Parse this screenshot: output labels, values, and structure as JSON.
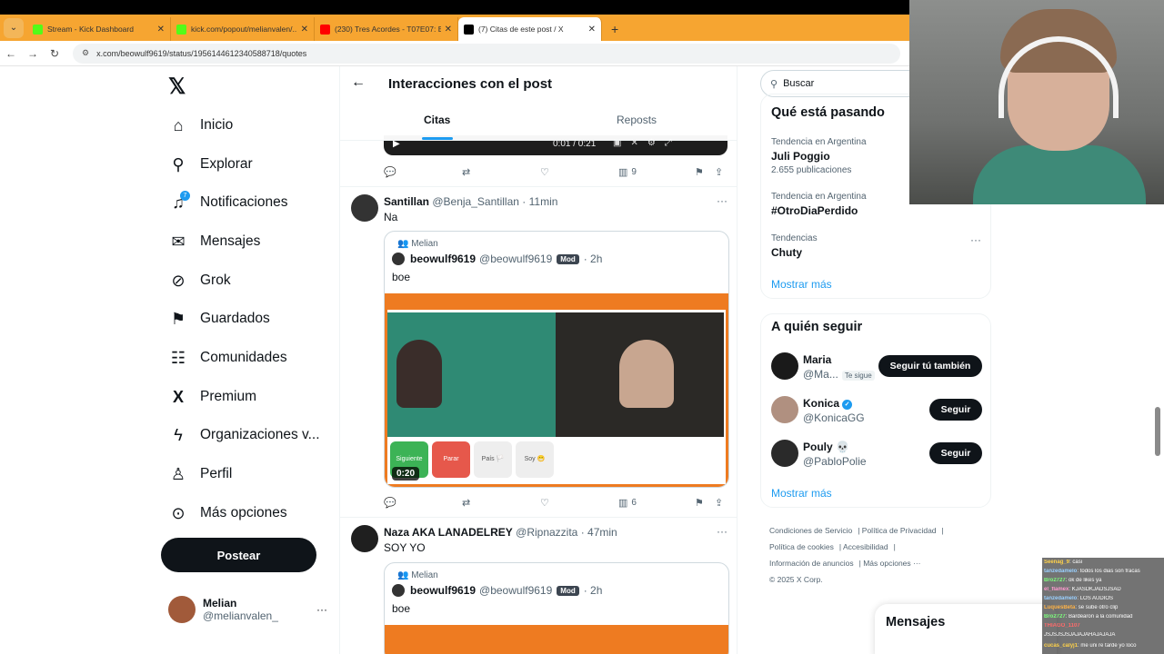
{
  "browser": {
    "tabs": [
      {
        "label": "Stream - Kick Dashboard",
        "color": "#53fc18"
      },
      {
        "label": "kick.com/popout/melianvalen/...",
        "color": "#53fc18"
      },
      {
        "label": "(230) Tres Acordes - T07E07: Es...",
        "color": "#ff0000"
      },
      {
        "label": "(7) Citas de este post / X",
        "color": "#000000"
      }
    ],
    "url": "x.com/beowulf9619/status/1956144612340588718/quotes"
  },
  "nav": {
    "items": [
      {
        "label": "Inicio",
        "icon": "home-icon",
        "glyph": "⌂"
      },
      {
        "label": "Explorar",
        "icon": "search-icon",
        "glyph": "⚲"
      },
      {
        "label": "Notificaciones",
        "icon": "bell-icon",
        "glyph": "🔔",
        "badge": "7"
      },
      {
        "label": "Mensajes",
        "icon": "mail-icon",
        "glyph": "✉"
      },
      {
        "label": "Grok",
        "icon": "grok-icon",
        "glyph": "⊘"
      },
      {
        "label": "Guardados",
        "icon": "bookmark-icon",
        "glyph": "⚑"
      },
      {
        "label": "Comunidades",
        "icon": "communities-icon",
        "glyph": "☷"
      },
      {
        "label": "Premium",
        "icon": "x-premium-icon",
        "glyph": "𝕏"
      },
      {
        "label": "Organizaciones v...",
        "icon": "lightning-icon",
        "glyph": "⚡"
      },
      {
        "label": "Perfil",
        "icon": "person-icon",
        "glyph": "☺"
      },
      {
        "label": "Más opciones",
        "icon": "more-circle-icon",
        "glyph": "⊙"
      }
    ],
    "post_label": "Postear",
    "me": {
      "name": "Melian",
      "handle": "@melianvalen_"
    }
  },
  "center": {
    "title": "Interacciones con el post",
    "tabs": [
      "Citas",
      "Reposts"
    ],
    "video_time": "0:01 / 0:21",
    "first_views": "9",
    "posts": [
      {
        "name": "Santillan",
        "handle": "@Benja_Santillan",
        "time": "· 11min",
        "text": "Na",
        "quote": {
          "community": "Melian",
          "name": "beowulf9619",
          "handle": "@beowulf9619",
          "badge": "Mod",
          "time": "· 2h",
          "text": "boe",
          "duration": "0:20"
        },
        "views": "6"
      },
      {
        "name": "Naza AKA LANADELREY",
        "handle": "@Ripnazzita",
        "time": "· 47min",
        "text": "SOY YO",
        "quote": {
          "community": "Melian",
          "name": "beowulf9619",
          "handle": "@beowulf9619",
          "badge": "Mod",
          "time": "· 2h",
          "text": "boe"
        }
      }
    ],
    "media_buttons": [
      "Siguiente",
      "Parar",
      "País 🏳️",
      "Soy 😁"
    ]
  },
  "right": {
    "search_placeholder": "Buscar",
    "trends_title": "Qué está pasando",
    "trends": [
      {
        "context": "Tendencia en Argentina",
        "name": "Juli Poggio",
        "count": "2.655 publicaciones"
      },
      {
        "context": "Tendencia en Argentina",
        "name": "#OtroDiaPerdido",
        "count": ""
      },
      {
        "context": "Tendencias",
        "name": "Chuty",
        "count": ""
      }
    ],
    "show_more": "Mostrar más",
    "follow_title": "A quién seguir",
    "follow": [
      {
        "name": "Maria",
        "handle": "@Ma...",
        "tag": "Te sigue",
        "button": "Seguir tú también",
        "color": "#1a1a1a"
      },
      {
        "name": "Konica",
        "handle": "@KonicaGG",
        "verified": true,
        "button": "Seguir",
        "color": "#b09080"
      },
      {
        "name": "Pouly 💀",
        "handle": "@PabloPolie",
        "button": "Seguir",
        "color": "#2a2a2a"
      }
    ],
    "footer": [
      "Condiciones de Servicio",
      "Política de Privacidad",
      "Política de cookies",
      "Accesibilidad",
      "Información de anuncios",
      "Más opciones ···",
      "© 2025 X Corp."
    ],
    "messages": "Mensajes"
  },
  "chat": [
    {
      "user": "Seenag_9",
      "msg": "casi"
    },
    {
      "user": "tanzedamelo",
      "msg": "todos los dias son fracas"
    },
    {
      "user": "Bro2727",
      "msg": "ok de likes ya"
    },
    {
      "user": "el_flamex",
      "msg": "KJASDKJADSJSAD"
    },
    {
      "user": "tanzedamelo",
      "msg": "LOS AUDIOS"
    },
    {
      "user": "LuquesBeta",
      "msg": "se sube otro clip"
    },
    {
      "user": "Bro2727",
      "msg": "Bardearon a la comunidad"
    },
    {
      "user": "THIAGO_1107",
      "msg": ""
    },
    {
      "user": "",
      "msg": "JSJSJSJSJAJAJAHAJAJAJA"
    },
    {
      "user": "cucas_calyj1",
      "msg": "me uni re tarde yo loco"
    }
  ]
}
